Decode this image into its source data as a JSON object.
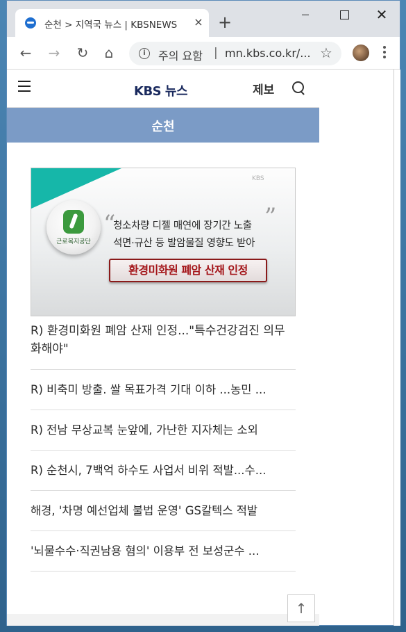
{
  "browser": {
    "tab_title": "순천 > 지역국 뉴스 | KBSNEWS",
    "tab_close": "×",
    "new_tab": "+",
    "omnibox_warning": "주의 요함",
    "omnibox_separator": "|",
    "url": "mn.kbs.co.kr/...",
    "win_close": "✕"
  },
  "site": {
    "logo": "KBS 뉴스",
    "report_label": "제보",
    "region": "순천"
  },
  "hero": {
    "badge_text": "근로복지공단",
    "watermark": "KBS",
    "quote_open": "“",
    "quote_close": "”",
    "line1": "청소차량 디젤 매연에 장기간 노출",
    "line2": "석면·규산 등 발암물질 영향도 받아",
    "banner": "환경미화원 폐암 산재 인정"
  },
  "main_headline": "R) 환경미화원 폐암 산재 인정...\"특수건강검진 의무화해야\"",
  "news_items": [
    "R) 비축미 방출. 쌀 목표가격 기대 이하 ...농민 ...",
    "R) 전남 무상교복 눈앞에, 가난한 지자체는 소외",
    "R) 순천시, 7백억 하수도 사업서 비위 적발...수...",
    "해경, '차명 예선업체 불법 운영' GS칼텍스 적발",
    "'뇌물수수·직권남용 혐의' 이용부 전 보성군수 ..."
  ],
  "top_button": "↑",
  "colors": {
    "region_bar": "#7b9bc6",
    "logo": "#1a2a5e",
    "banner_text": "#a4161a"
  }
}
